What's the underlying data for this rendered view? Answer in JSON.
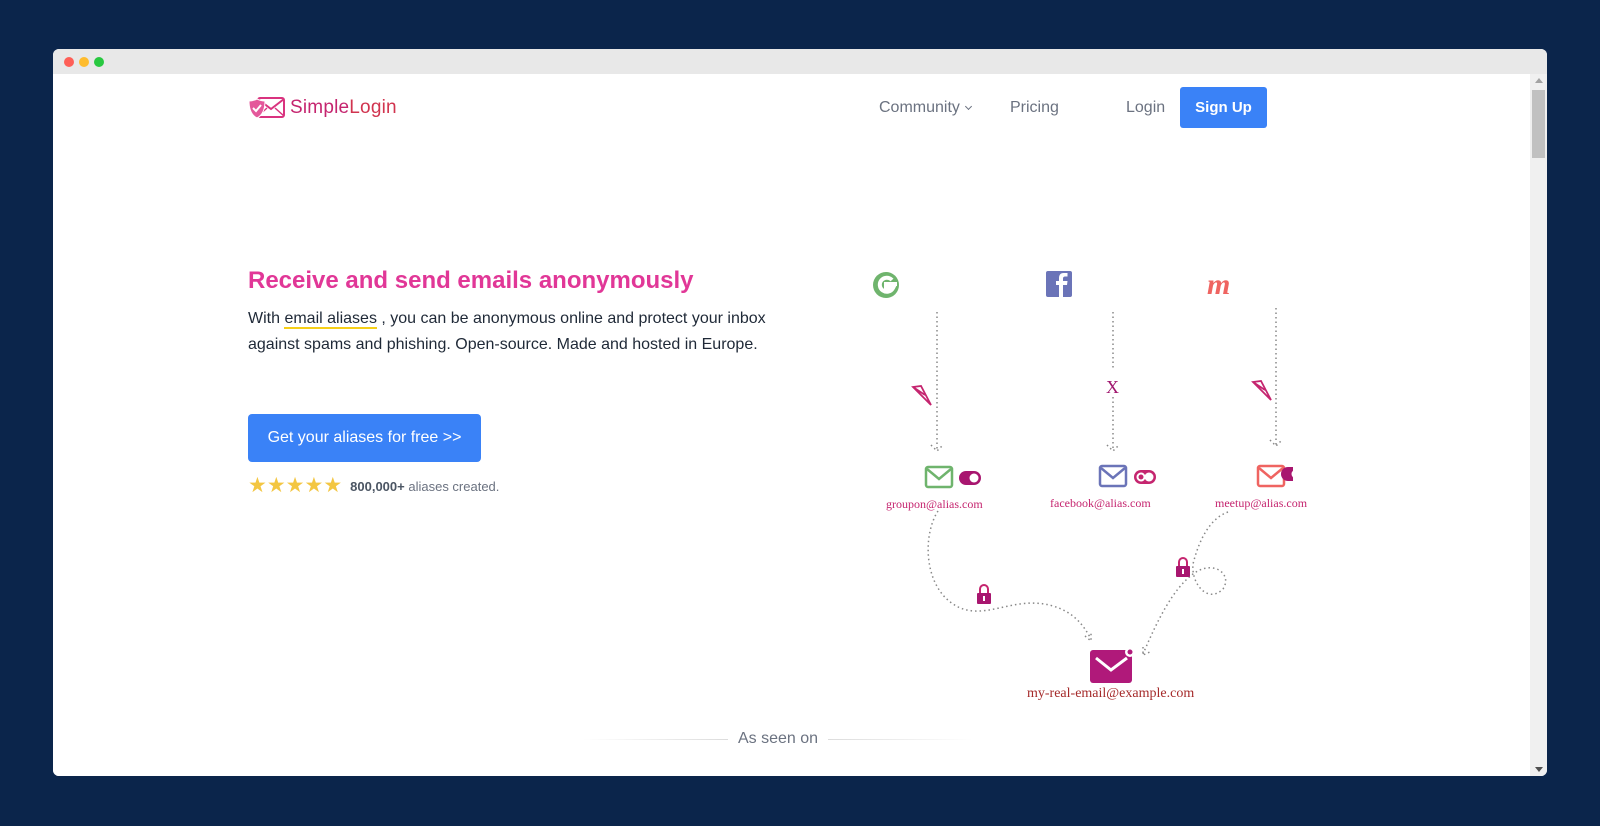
{
  "window": {
    "controls": [
      "close",
      "minimize",
      "maximize"
    ]
  },
  "nav": {
    "logo_text_part1": "Simple",
    "logo_text_part2": "Login",
    "community": "Community",
    "pricing": "Pricing",
    "login": "Login",
    "signup": "Sign Up"
  },
  "hero": {
    "title": "Receive and send emails anonymously",
    "desc_prefix": "With ",
    "desc_link": "email aliases",
    "desc_suffix": " , you can be anonymous online and protect your inbox against spams and phishing. Open-source. Made and hosted in Europe.",
    "cta": "Get your aliases for free >>",
    "rating_stars": 5,
    "rating_count": "800,000+",
    "rating_suffix": " aliases created."
  },
  "diagram": {
    "services": [
      {
        "name": "Groupon",
        "icon": "groupon-g-icon",
        "alias": "groupon@alias.com",
        "color": "#6fb46d",
        "enabled": true
      },
      {
        "name": "Facebook",
        "icon": "facebook-icon",
        "alias": "facebook@alias.com",
        "color": "#6b74b8",
        "enabled": false,
        "blocked_mark": "X"
      },
      {
        "name": "Meetup",
        "icon": "meetup-icon",
        "alias": "meetup@alias.com",
        "color": "#ef6461",
        "enabled": true
      }
    ],
    "real_email": "my-real-email@example.com",
    "accent": "#a8166f"
  },
  "seen_on": "As seen on",
  "colors": {
    "background": "#0b254b",
    "primary_button": "#3a82f7",
    "title_pink": "#e13797",
    "link_underline": "#f6cf18",
    "star": "#f3c642"
  }
}
